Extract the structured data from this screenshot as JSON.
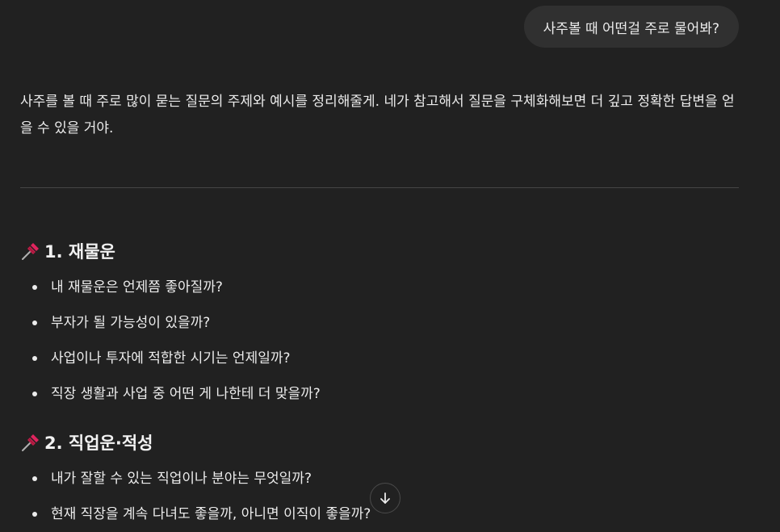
{
  "user_message": "사주볼 때 어떤걸 주로 물어봐?",
  "assistant": {
    "intro": "사주를 볼 때 주로 많이 묻는 질문의 주제와 예시를 정리해줄게. 네가 참고해서 질문을 구체화해보면 더 깊고 정확한 답변을 얻을 수 있을 거야.",
    "sections": [
      {
        "icon": "pushpin-icon",
        "title": "1. 재물운",
        "items": [
          "내 재물운은 언제쯤 좋아질까?",
          "부자가 될 가능성이 있을까?",
          "사업이나 투자에 적합한 시기는 언제일까?",
          "직장 생활과 사업 중 어떤 게 나한테 더 맞을까?"
        ]
      },
      {
        "icon": "pushpin-icon",
        "title": "2. 직업운·적성",
        "items": [
          "내가 잘할 수 있는 직업이나 분야는 무엇일까?",
          "현재 직장을 계속 다녀도 좋을까, 아니면 이직이 좋을까?"
        ]
      }
    ]
  },
  "scroll_button": {
    "icon": "arrow-down-icon"
  },
  "colors": {
    "background": "#212121",
    "user_bubble": "#303030",
    "text": "#ececec",
    "pin": "#e0245e"
  }
}
